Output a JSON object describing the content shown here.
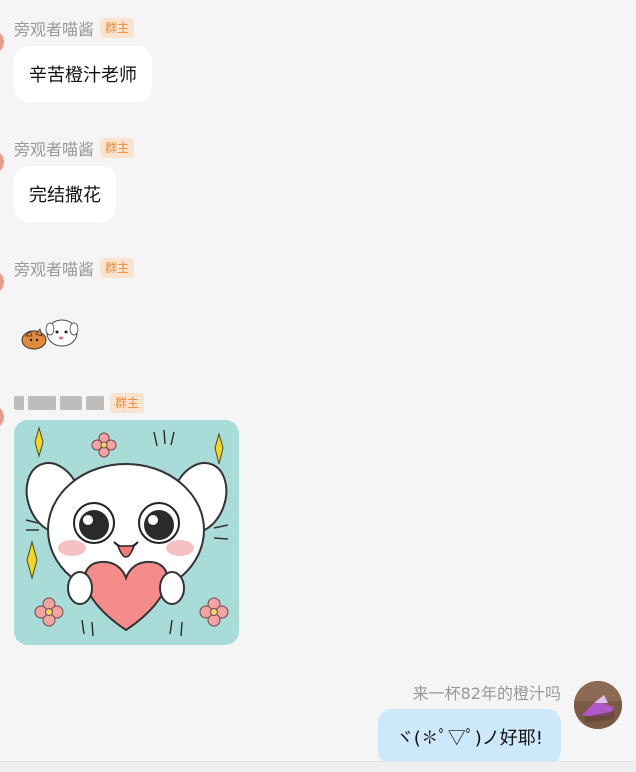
{
  "messages": [
    {
      "sender": "旁观者喵酱",
      "badge": "群主",
      "text": "辛苦橙汁老师"
    },
    {
      "sender": "旁观者喵酱",
      "badge": "群主",
      "text": "完结撒花"
    },
    {
      "sender": "旁观者喵酱",
      "badge": "群主",
      "sticker": "cat-dog-sticker"
    },
    {
      "badge": "群主",
      "image": "puppy-heart-sticker"
    }
  ],
  "self": {
    "name": "来一杯82年的橙汁吗",
    "text": "ヾ(✽ﾟ▽ﾟ)ノ好耶!"
  },
  "colors": {
    "background": "#f5f5f5",
    "incoming_bubble": "#ffffff",
    "outgoing_bubble": "#cde8fb",
    "badge_bg": "#fbe3d1",
    "badge_text": "#f08a3b"
  }
}
